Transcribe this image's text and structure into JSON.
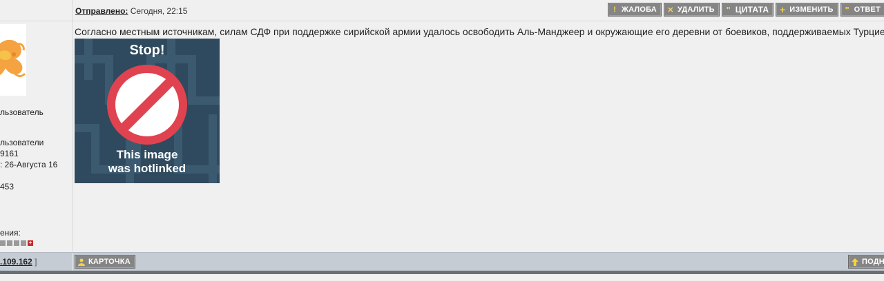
{
  "header": {
    "posted_label": "Отправлено:",
    "posted_time": "Сегодня, 22:15"
  },
  "actions": [
    {
      "label": "ЖАЛОБА",
      "icon": "exclamation-icon"
    },
    {
      "label": "УДАЛИТЬ",
      "icon": "x-icon"
    },
    {
      "label": "ЦИТАТА",
      "icon": "quote-icon"
    },
    {
      "label": "ИЗМЕНИТЬ",
      "icon": "plus-icon"
    },
    {
      "label": "ОТВЕТ",
      "icon": "quote-icon"
    }
  ],
  "sidebar": {
    "group": "льзователь",
    "group2": "льзователи",
    "posts": "9161",
    "registered": ": 26-Августа 16",
    "number": "453",
    "warnings_label": "ения:"
  },
  "post": {
    "text": "Согласно местным источникам, силам СДФ при поддержке сирийской армии удалось освободить Аль-Манджеер и окружающие его деревни от боевиков, поддерживаемых Турцией.",
    "image": {
      "title": "Stop!",
      "line1": "This image",
      "line2": "was hotlinked"
    }
  },
  "footer": {
    "ip": ".109.162",
    "ip_bracket": "]",
    "card_label": "КАРТОЧКА",
    "up_label": "ПОДН"
  },
  "colors": {
    "button_bg": "#858585",
    "footer_bg": "#c6ccd4",
    "hotlink_bg": "#2f4a5e",
    "stop_red": "#e0434f"
  }
}
